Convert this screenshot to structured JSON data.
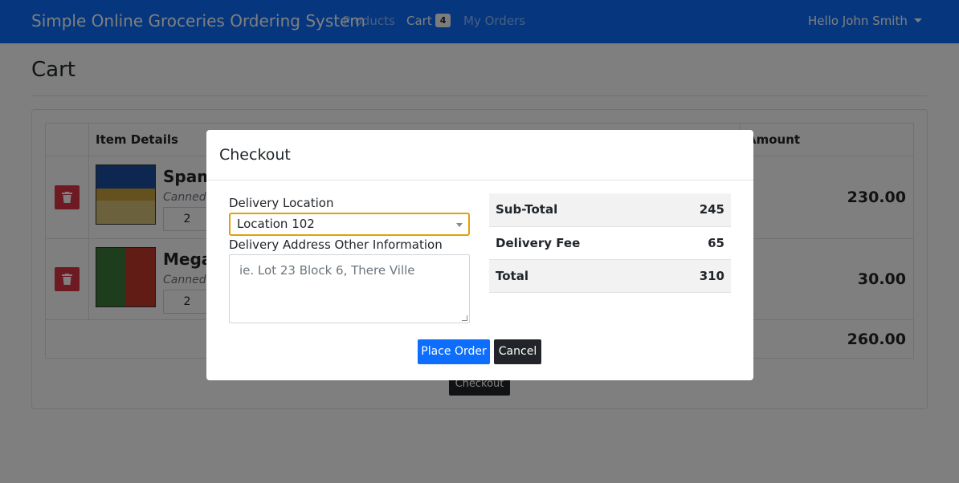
{
  "navbar": {
    "brand": "Simple Online Groceries Ordering System",
    "links": [
      {
        "label": "Products",
        "active": false
      },
      {
        "label": "Cart",
        "active": true,
        "badge": "4"
      },
      {
        "label": "My Orders",
        "active": false
      }
    ],
    "user_menu": "Hello John Smith"
  },
  "page": {
    "title": "Cart",
    "table": {
      "headers": [
        "",
        "Item Details",
        "Amount"
      ],
      "rows": [
        {
          "name": "Spam",
          "category": "Canned Goods",
          "quantity": "2",
          "amount": "230.00",
          "image": "spam-can"
        },
        {
          "name": "Mega Sardines",
          "category": "Canned Goods",
          "quantity": "2",
          "amount": "30.00",
          "image": "mega-sardines-cans"
        }
      ],
      "total": "260.00"
    },
    "checkout_label": "Checkout"
  },
  "modal": {
    "title": "Checkout",
    "delivery_location_label": "Delivery Location",
    "delivery_location_value": "Location 102",
    "address_label": "Delivery Address Other Information",
    "address_placeholder": "ie. Lot 23 Block 6, There Ville",
    "summary": [
      {
        "label": "Sub-Total",
        "value": "245"
      },
      {
        "label": "Delivery Fee",
        "value": "65"
      },
      {
        "label": "Total",
        "value": "310"
      }
    ],
    "place_order_label": "Place Order",
    "cancel_label": "Cancel"
  }
}
